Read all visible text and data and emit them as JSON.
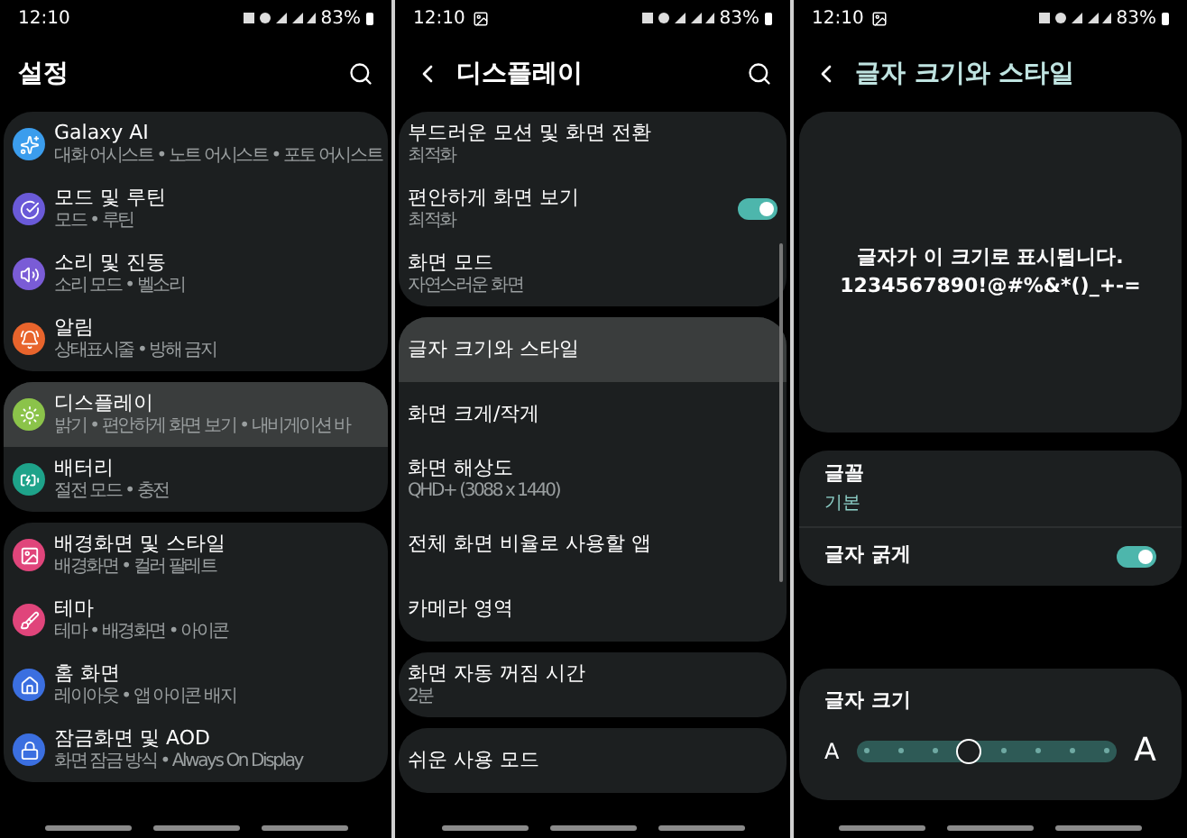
{
  "panels": [
    {
      "kind": "list",
      "status": {
        "time": "12:10",
        "battery": "83%"
      },
      "title": "설정",
      "search": true,
      "groups": [
        {
          "items": [
            {
              "label": "Galaxy AI",
              "subtitle": "대화 어시스트 • 노트 어시스트 • 포토 어시스트",
              "color": "#3b9ded",
              "selected": false
            },
            {
              "label": "모드 및 루틴",
              "subtitle": "모드 • 루틴",
              "color": "#6a5ad8",
              "selected": false
            },
            {
              "label": "소리 및 진동",
              "subtitle": "소리 모드 • 벨소리",
              "color": "#7a5cd6",
              "selected": false
            },
            {
              "label": "알림",
              "subtitle": "상태표시줄 • 방해 금지",
              "color": "#e8642c",
              "selected": false
            }
          ]
        },
        {
          "items": [
            {
              "label": "디스플레이",
              "subtitle": "밝기 • 편안하게 화면 보기 • 내비게이션 바",
              "color": "#8bc34a",
              "selected": true
            },
            {
              "label": "배터리",
              "subtitle": "절전 모드 • 충전",
              "color": "#1ea38a",
              "selected": false
            }
          ]
        },
        {
          "items": [
            {
              "label": "배경화면 및 스타일",
              "subtitle": "배경화면 • 컬러 팔레트",
              "color": "#e0457b",
              "selected": false
            },
            {
              "label": "테마",
              "subtitle": "테마 • 배경화면 • 아이콘",
              "color": "#e0457b",
              "selected": false
            },
            {
              "label": "홈 화면",
              "subtitle": "레이아웃 • 앱 아이콘 배지",
              "color": "#3b6fe0",
              "selected": false
            },
            {
              "label": "잠금화면 및 AOD",
              "subtitle": "화면 잠금 방식 • Always On Display",
              "color": "#3b6fe0",
              "selected": false
            }
          ]
        }
      ]
    },
    {
      "kind": "list",
      "status": {
        "time": "12:10",
        "battery": "83%",
        "image_notification": true
      },
      "title": "디스플레이",
      "back": true,
      "search": true,
      "groups": [
        {
          "items": [
            {
              "label": "부드러운 모션 및 화면 전환",
              "subtitle": "최적화",
              "selected": false
            },
            {
              "label": "편안하게 화면 보기",
              "subtitle": "최적화",
              "selected": false,
              "kind": "toggle",
              "on": true
            },
            {
              "label": "화면 모드",
              "subtitle": "자연스러운 화면",
              "selected": false
            }
          ]
        },
        {
          "items": [
            {
              "label": "글자 크기와 스타일",
              "selected": true
            },
            {
              "label": "화면 크게/작게",
              "selected": false
            },
            {
              "label": "화면 해상도",
              "subtitle": "QHD+ (3088 x 1440)",
              "selected": false
            },
            {
              "label": "전체 화면 비율로 사용할 앱",
              "selected": false
            },
            {
              "label": "카메라 영역",
              "selected": false
            }
          ]
        },
        {
          "items": [
            {
              "label": "화면 자동 꺼짐 시간",
              "subtitle": "2분",
              "selected": false
            }
          ]
        },
        {
          "items": [
            {
              "label": "쉬운 사용 모드",
              "selected": false
            }
          ]
        }
      ]
    },
    {
      "kind": "font",
      "status": {
        "time": "12:10",
        "battery": "83%",
        "image_notification": true
      },
      "title": "글자 크기와 스타일",
      "back": true,
      "preview": [
        "글자가 이 크기로 표시됩니다.",
        "1234567890!@#%&*()_+-="
      ],
      "font": {
        "label": "글꼴",
        "value": "기본"
      },
      "bold": {
        "label": "글자 굵게",
        "on": true
      },
      "size": {
        "label": "글자 크기",
        "small": "A",
        "large": "A",
        "level": 0.43
      }
    }
  ]
}
